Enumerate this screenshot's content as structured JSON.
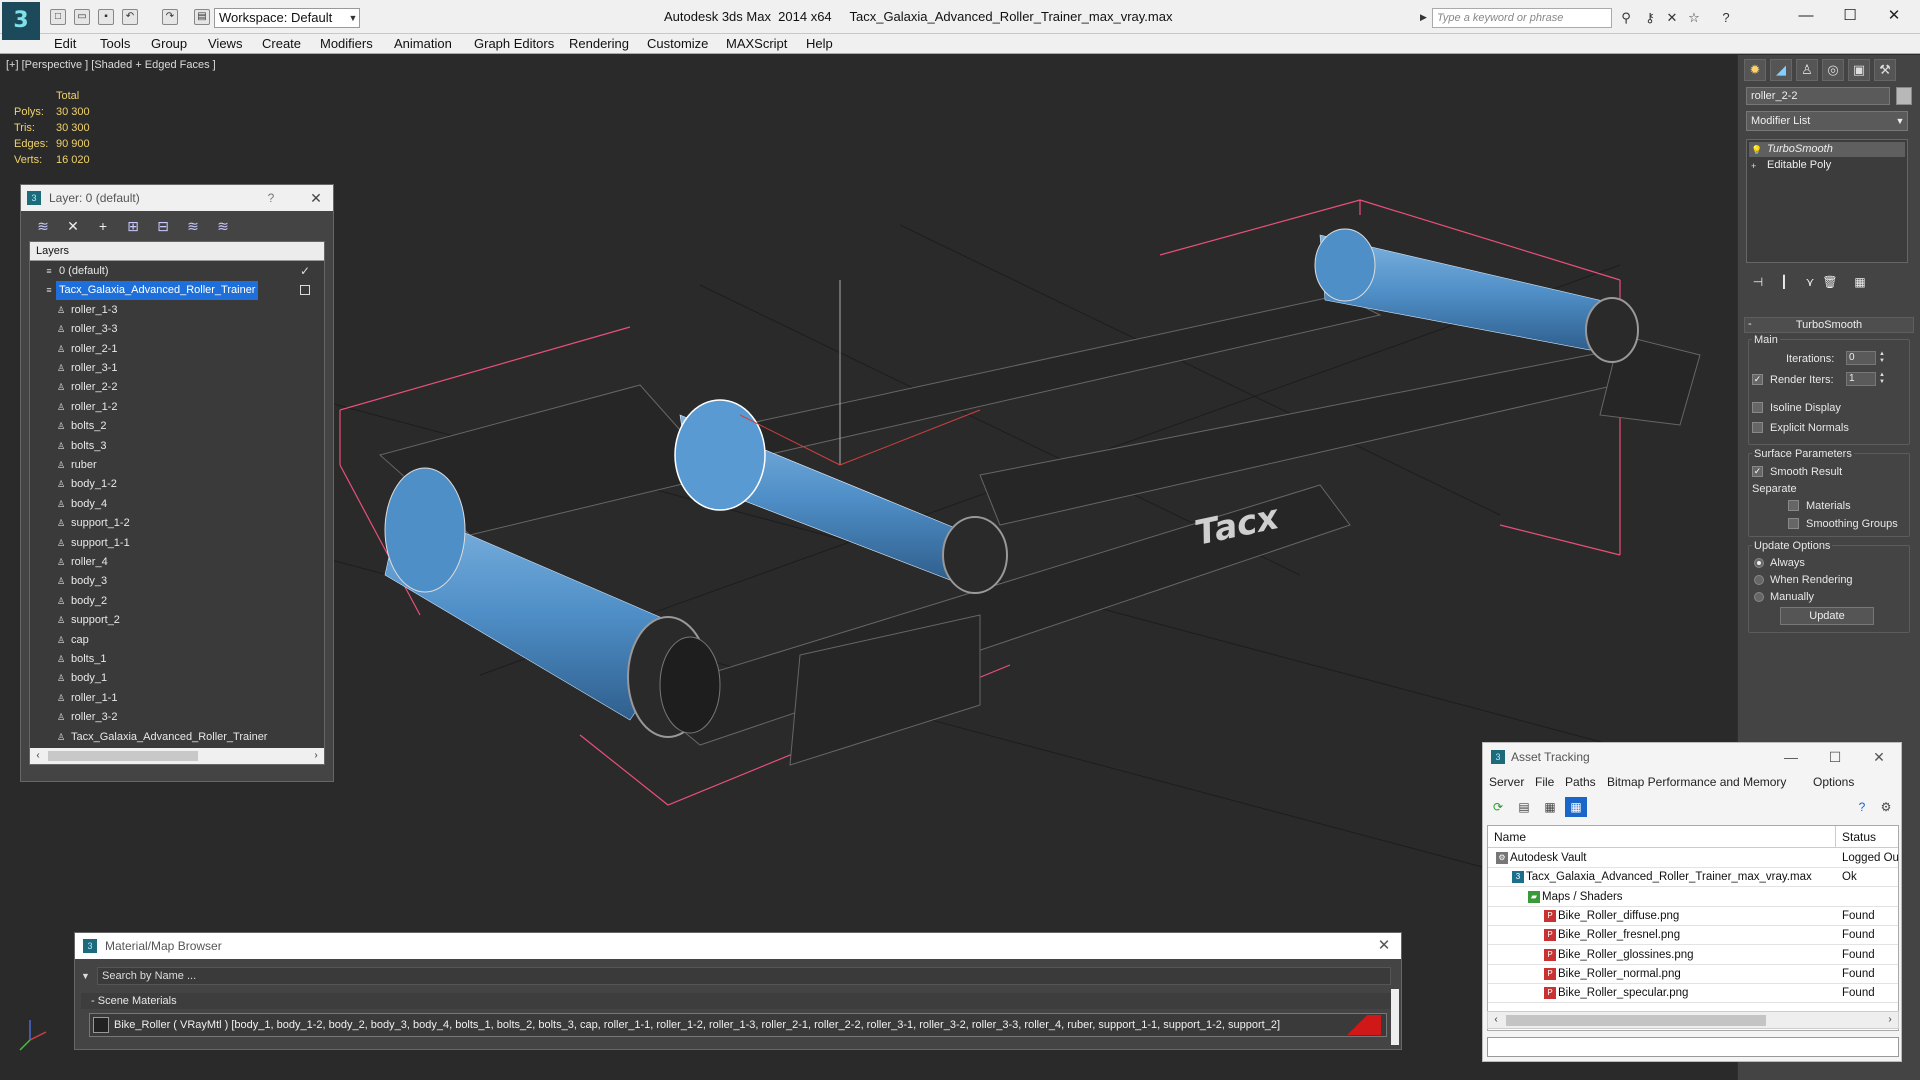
{
  "app": {
    "title": "Autodesk 3ds Max  2014 x64     Tacx_Galaxia_Advanced_Roller_Trainer_max_vray.max",
    "workspace": "Workspace: Default",
    "search_placeholder": "Type a keyword or phrase"
  },
  "menu": [
    "Edit",
    "Tools",
    "Group",
    "Views",
    "Create",
    "Modifiers",
    "Animation",
    "Graph Editors",
    "Rendering",
    "Customize",
    "MAXScript",
    "Help"
  ],
  "viewport": {
    "label": "[+] [Perspective ] [Shaded + Edged Faces ]",
    "stats_header": "Total",
    "stats": [
      {
        "key": "Polys:",
        "value": "30 300"
      },
      {
        "key": "Tris:",
        "value": "30 300"
      },
      {
        "key": "Edges:",
        "value": "90 900"
      },
      {
        "key": "Verts:",
        "value": "16 020"
      }
    ],
    "logo_text": "Tacx"
  },
  "layer_dialog": {
    "title": "Layer: 0 (default)",
    "help": "?",
    "header": "Layers",
    "rows": [
      {
        "label": "0 (default)",
        "level": 0,
        "checked": true
      },
      {
        "label": "Tacx_Galaxia_Advanced_Roller_Trainer",
        "level": 0,
        "selected": true
      },
      {
        "label": "roller_1-3",
        "level": 1
      },
      {
        "label": "roller_3-3",
        "level": 1
      },
      {
        "label": "roller_2-1",
        "level": 1
      },
      {
        "label": "roller_3-1",
        "level": 1
      },
      {
        "label": "roller_2-2",
        "level": 1
      },
      {
        "label": "roller_1-2",
        "level": 1
      },
      {
        "label": "bolts_2",
        "level": 1
      },
      {
        "label": "bolts_3",
        "level": 1
      },
      {
        "label": "ruber",
        "level": 1
      },
      {
        "label": "body_1-2",
        "level": 1
      },
      {
        "label": "body_4",
        "level": 1
      },
      {
        "label": "support_1-2",
        "level": 1
      },
      {
        "label": "support_1-1",
        "level": 1
      },
      {
        "label": "roller_4",
        "level": 1
      },
      {
        "label": "body_3",
        "level": 1
      },
      {
        "label": "body_2",
        "level": 1
      },
      {
        "label": "support_2",
        "level": 1
      },
      {
        "label": "cap",
        "level": 1
      },
      {
        "label": "bolts_1",
        "level": 1
      },
      {
        "label": "body_1",
        "level": 1
      },
      {
        "label": "roller_1-1",
        "level": 1
      },
      {
        "label": "roller_3-2",
        "level": 1
      },
      {
        "label": "Tacx_Galaxia_Advanced_Roller_Trainer",
        "level": 1
      }
    ]
  },
  "command_panel": {
    "object_name": "roller_2-2",
    "modifier_list": "Modifier List",
    "stack": [
      "TurboSmooth",
      "Editable Poly"
    ],
    "turbosmooth": {
      "title": "TurboSmooth",
      "main": "Main",
      "iterations_label": "Iterations:",
      "iterations_value": "0",
      "render_iters_label": "Render Iters:",
      "render_iters_value": "1",
      "isoline": "Isoline Display",
      "explicit_normals": "Explicit Normals",
      "surface_params": "Surface Parameters",
      "smooth_result": "Smooth Result",
      "separate": "Separate",
      "materials": "Materials",
      "smoothing_groups": "Smoothing Groups",
      "update_options": "Update Options",
      "always": "Always",
      "when_rendering": "When Rendering",
      "manually": "Manually",
      "update_button": "Update"
    }
  },
  "material_browser": {
    "title": "Material/Map Browser",
    "search_placeholder": "Search by Name ...",
    "group": "Scene Materials",
    "material_row": "Bike_Roller  ( VRayMtl )  [body_1, body_1-2, body_2, body_3, body_4, bolts_1, bolts_2, bolts_3, cap, roller_1-1, roller_1-2, roller_1-3, roller_2-1, roller_2-2, roller_3-1, roller_3-2, roller_3-3, roller_4, ruber, support_1-1, support_1-2, support_2]"
  },
  "asset_tracking": {
    "title": "Asset Tracking",
    "menu": [
      "Server",
      "File",
      "Paths",
      "Bitmap Performance and Memory",
      "Options"
    ],
    "col_name": "Name",
    "col_status": "Status",
    "rows": [
      {
        "name": "Autodesk Vault",
        "status": "Logged Out",
        "indent": 1,
        "icon": "vault-icon"
      },
      {
        "name": "Tacx_Galaxia_Advanced_Roller_Trainer_max_vray.max",
        "status": "Ok",
        "indent": 2,
        "icon": "max-file-icon"
      },
      {
        "name": "Maps / Shaders",
        "status": "",
        "indent": 3,
        "icon": "maps-folder-icon"
      },
      {
        "name": "Bike_Roller_diffuse.png",
        "status": "Found",
        "indent": 4,
        "icon": "png-icon"
      },
      {
        "name": "Bike_Roller_fresnel.png",
        "status": "Found",
        "indent": 4,
        "icon": "png-icon"
      },
      {
        "name": "Bike_Roller_glossines.png",
        "status": "Found",
        "indent": 4,
        "icon": "png-icon"
      },
      {
        "name": "Bike_Roller_normal.png",
        "status": "Found",
        "indent": 4,
        "icon": "png-icon"
      },
      {
        "name": "Bike_Roller_specular.png",
        "status": "Found",
        "indent": 4,
        "icon": "png-icon"
      }
    ]
  },
  "colors": {
    "selection": "#1e6fd9",
    "roller_blue": "#4f8fc7",
    "stats_yellow": "#f0d26a",
    "bbox_pink": "#e8507a"
  }
}
